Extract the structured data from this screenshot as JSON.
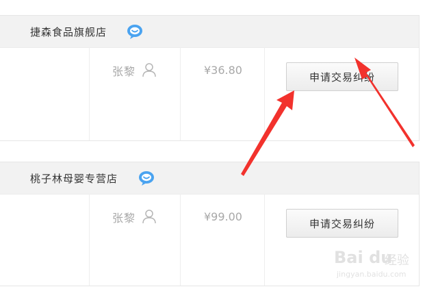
{
  "orders": [
    {
      "shop_name": "捷森食品旗舰店",
      "chat_icon": "chat-bubble-icon",
      "buyer": "张黎",
      "buyer_icon": "person-outline-icon",
      "price": "¥36.80",
      "action_label": "申请交易纠纷"
    },
    {
      "shop_name": "桃子林母婴专营店",
      "chat_icon": "chat-bubble-icon",
      "buyer": "张黎",
      "buyer_icon": "person-outline-icon",
      "price": "¥99.00",
      "action_label": "申请交易纠纷"
    }
  ],
  "colors": {
    "header_bg": "#f2f2f2",
    "chat_icon": "#4aa3f0",
    "muted_text": "#a8a8a8",
    "arrow": "#f2322d"
  },
  "watermark": {
    "logo": "Bai du",
    "text": "经验",
    "url": "jingyan.baidu.com"
  }
}
